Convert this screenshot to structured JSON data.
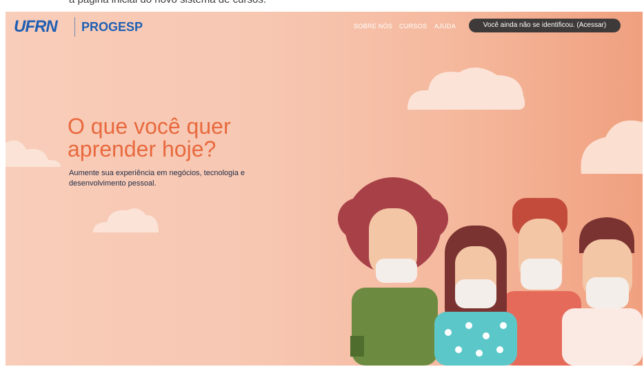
{
  "caption": {
    "text": "a página inicial do novo sistema de cursos."
  },
  "header": {
    "logo_text": "UFRN",
    "brand": "PROGESP",
    "nav": [
      "SOBRE NÓS",
      "CURSOS",
      "AJUDA"
    ],
    "login_text": "Você ainda não se identificou. (Acessar)"
  },
  "hero": {
    "title": "O que você quer aprender hoje?",
    "subtitle": "Aumente sua experiência em negócios, tecnologia e desenvolvimento pessoal."
  },
  "colors": {
    "bg_start": "#f8cdb9",
    "bg_end": "#f0a07f",
    "accent": "#e8693e",
    "logo_blue": "#1e5fb3",
    "pill_bg": "#3d3a39"
  },
  "illustration": {
    "name": "people-with-masks"
  }
}
